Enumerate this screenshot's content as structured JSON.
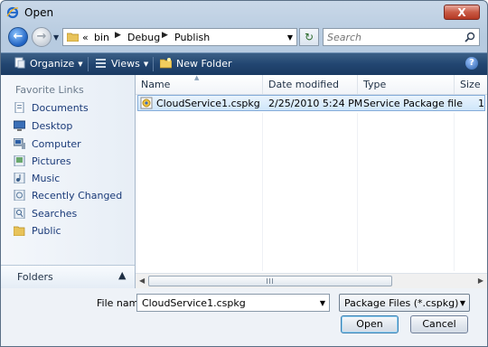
{
  "window": {
    "title": "Open",
    "close_glyph": "X"
  },
  "address": {
    "overflow": "«",
    "crumbs": [
      "bin",
      "Debug",
      "Publish"
    ],
    "search_placeholder": "Search"
  },
  "toolbar": {
    "organize": "Organize",
    "views": "Views",
    "new_folder": "New Folder",
    "help": "?"
  },
  "favorites": {
    "title": "Favorite Links",
    "items": [
      {
        "label": "Documents",
        "icon": "documents-icon"
      },
      {
        "label": "Desktop",
        "icon": "desktop-icon"
      },
      {
        "label": "Computer",
        "icon": "computer-icon"
      },
      {
        "label": "Pictures",
        "icon": "pictures-icon"
      },
      {
        "label": "Music",
        "icon": "music-icon"
      },
      {
        "label": "Recently Changed",
        "icon": "recent-icon"
      },
      {
        "label": "Searches",
        "icon": "searches-icon"
      },
      {
        "label": "Public",
        "icon": "public-folder-icon"
      }
    ],
    "folders_label": "Folders"
  },
  "columns": {
    "name": "Name",
    "date": "Date modified",
    "type": "Type",
    "size": "Size"
  },
  "files": [
    {
      "name": "CloudService1.cspkg",
      "date": "2/25/2010 5:24 PM",
      "type": "Service Package file",
      "size": "1"
    }
  ],
  "bottom": {
    "file_name_label": "File name:",
    "file_name_value": "CloudService1.cspkg",
    "filter": "Package Files (*.cspkg)",
    "open": "Open",
    "cancel": "Cancel"
  },
  "colors": {
    "toolbar": "#224671",
    "link": "#1a3a78",
    "selection": "#cfe6fa"
  }
}
